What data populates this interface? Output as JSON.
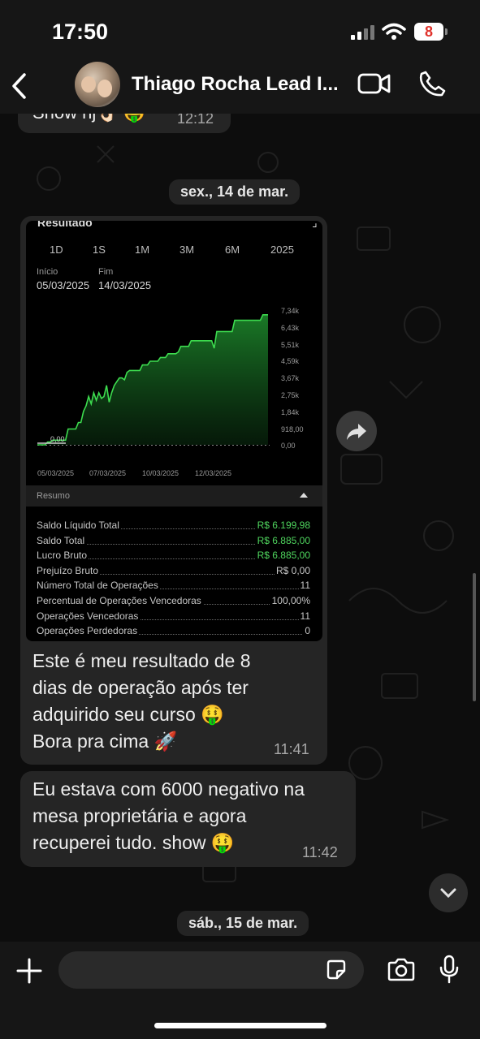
{
  "status_bar": {
    "time": "17:50",
    "battery": "8",
    "icons": [
      "signal-icon",
      "wifi-icon",
      "battery-icon"
    ]
  },
  "header": {
    "contact_name": "Thiago Rocha Lead I...",
    "icons": [
      "back-icon",
      "video-call-icon",
      "phone-icon"
    ]
  },
  "prev_message": {
    "text": "Show hj👌🏻 🤑",
    "time": "12:12"
  },
  "date_separators": [
    "sex., 14 de mar.",
    "sáb., 15 de mar."
  ],
  "screenshot": {
    "header_cut": "Resultado",
    "tabs": [
      "1D",
      "1S",
      "1M",
      "3M",
      "6M",
      "2025"
    ],
    "start_label": "Início",
    "end_label": "Fim",
    "start_date": "05/03/2025",
    "end_date": "14/03/2025",
    "zero_label": "0,00",
    "summary_label": "Resumo",
    "rows": [
      {
        "label": "Saldo Líquido Total",
        "value": "R$ 6.199,98",
        "green": true
      },
      {
        "label": "Saldo Total",
        "value": "R$ 6.885,00",
        "green": true
      },
      {
        "label": "Lucro Bruto",
        "value": "R$ 6.885,00",
        "green": true
      },
      {
        "label": "Prejuízo Bruto",
        "value": "R$ 0,00",
        "green": false
      },
      {
        "label": "Número Total de Operações",
        "value": "11",
        "green": false
      },
      {
        "label": "Percentual de Operações Vencedoras",
        "value": "100,00%",
        "green": false
      },
      {
        "label": "Operações Vencedoras",
        "value": "11",
        "green": false
      },
      {
        "label": "Operações Perdedoras",
        "value": "0",
        "green": false
      }
    ]
  },
  "chart_data": {
    "type": "area",
    "title": "",
    "xlabel": "",
    "ylabel": "",
    "y_tick_labels": [
      "7,34k",
      "6,43k",
      "5,51k",
      "4,59k",
      "3,67k",
      "2,75k",
      "1,84k",
      "918,00",
      "0,00"
    ],
    "x_tick_labels": [
      "05/03/2025",
      "07/03/2025",
      "10/03/2025",
      "12/03/2025"
    ],
    "ylim": [
      0,
      7340
    ],
    "grid": false,
    "series": [
      {
        "color": "#3ddc4f",
        "x": [
          0,
          0.05,
          0.1,
          0.15,
          0.2,
          0.25,
          0.3,
          0.35,
          0.4,
          0.45,
          0.5,
          0.55,
          0.6,
          0.65,
          0.7,
          0.75,
          0.8,
          0.85,
          0.9,
          0.95,
          1.0,
          1.05,
          1.1,
          1.15,
          1.2,
          1.25,
          1.3,
          1.35,
          1.4,
          1.45,
          1.5,
          1.55,
          1.6,
          1.65,
          1.7,
          1.75,
          1.8,
          1.85,
          1.9,
          1.95,
          2.0,
          2.05,
          2.1,
          2.15,
          2.2,
          2.25,
          2.3,
          2.35,
          2.4,
          2.45,
          2.5,
          2.55,
          2.6,
          2.65,
          2.7,
          2.75,
          2.8,
          2.85,
          2.9,
          2.95,
          3.0,
          3.05,
          3.1,
          3.15,
          3.2,
          3.25,
          3.3,
          3.35,
          3.4,
          3.45,
          3.5,
          3.55,
          3.6,
          3.65,
          3.7,
          3.75,
          3.8,
          3.85,
          3.9,
          3.95,
          4.0,
          4.05,
          4.1,
          4.15,
          4.2,
          4.25,
          4.3,
          4.35,
          4.4,
          4.45,
          4.5
        ],
        "y": [
          0,
          0,
          0,
          0,
          150,
          150,
          250,
          250,
          250,
          250,
          250,
          250,
          850,
          850,
          850,
          850,
          1200,
          1200,
          1800,
          2100,
          2600,
          2200,
          2800,
          2400,
          2800,
          2500,
          2600,
          3200,
          2300,
          2800,
          3200,
          3400,
          3600,
          3600,
          3500,
          3900,
          4000,
          4000,
          4000,
          4000,
          4000,
          4300,
          4300,
          4300,
          4500,
          4500,
          4500,
          4500,
          4700,
          4700,
          4700,
          4900,
          4900,
          4900,
          4900,
          5000,
          5300,
          5300,
          5300,
          5300,
          5600,
          5600,
          5600,
          5600,
          5600,
          5600,
          5600,
          5600,
          5600,
          5200,
          6100,
          6100,
          6100,
          6100,
          6100,
          6100,
          6100,
          6700,
          6700,
          6700,
          6700,
          6700,
          6700,
          6700,
          6700,
          6700,
          6700,
          6700,
          7000,
          7000,
          7000
        ]
      }
    ]
  },
  "message1": {
    "lines": [
      "Este é meu resultado de 8",
      "dias de operação após ter",
      "adquirido seu curso 🤑",
      "Bora pra cima 🚀"
    ],
    "time": "11:41"
  },
  "message2": {
    "lines": [
      "Eu estava com 6000 negativo na",
      "mesa proprietária e agora",
      "recuperei tudo. show  🤑"
    ],
    "time": "11:42"
  },
  "colors": {
    "bubble": "#252525",
    "chart_line": "#3ddc4f",
    "value_green": "#4fd65e",
    "header_bg": "#161616"
  },
  "bottom_icons": [
    "plus-icon",
    "sticker-icon",
    "camera-icon",
    "microphone-icon"
  ]
}
